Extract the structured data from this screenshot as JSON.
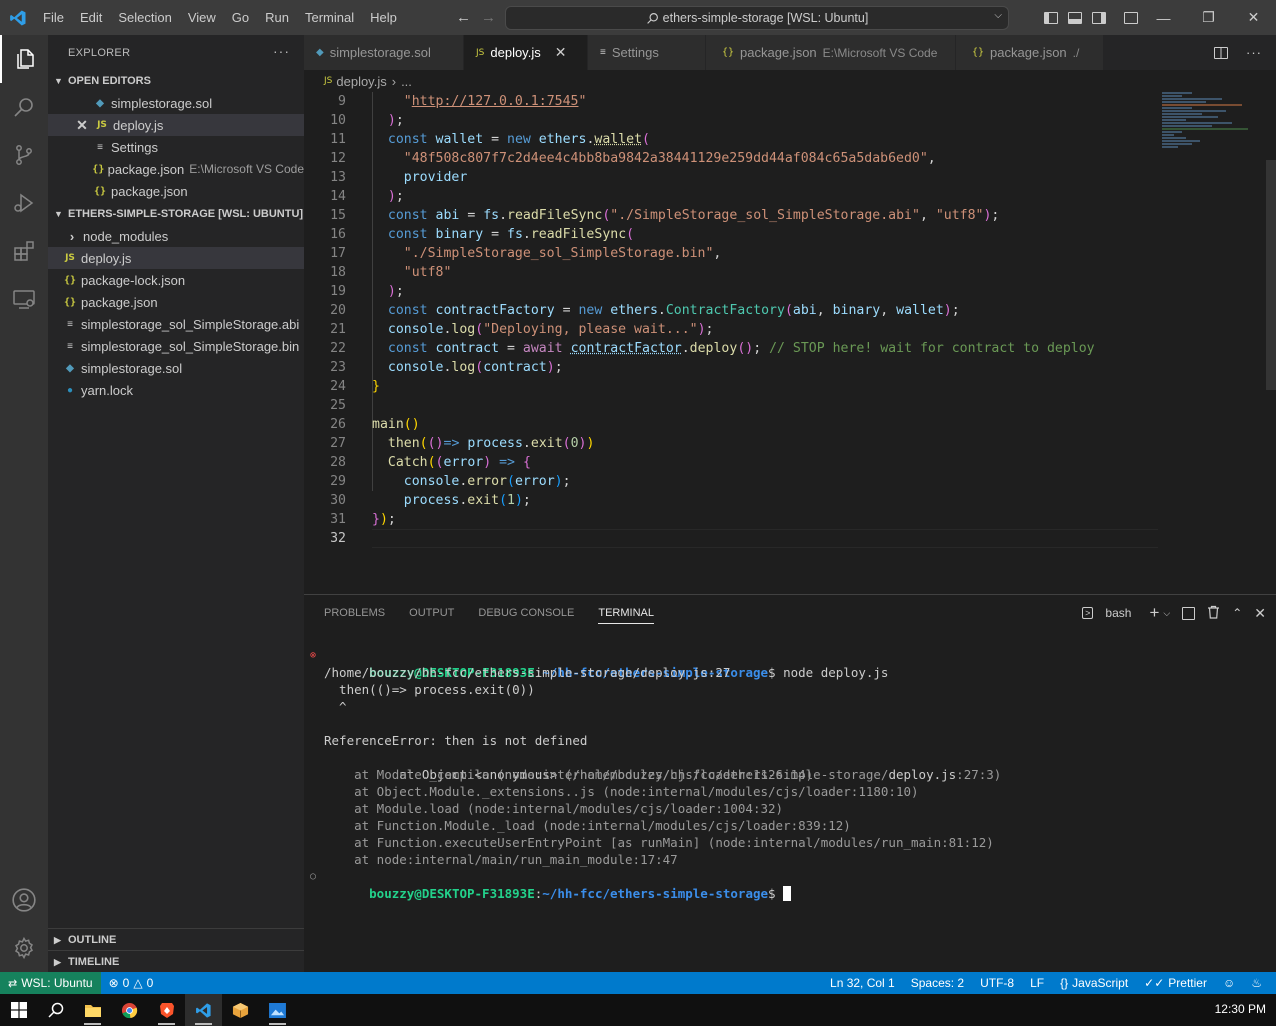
{
  "titlebar": {
    "menu": [
      "File",
      "Edit",
      "Selection",
      "View",
      "Go",
      "Run",
      "Terminal",
      "Help"
    ],
    "command_center": "ethers-simple-storage [WSL: Ubuntu]"
  },
  "sidebar": {
    "header": "EXPLORER",
    "open_editors_title": "OPEN EDITORS",
    "open_editors": [
      {
        "name": "simplestorage.sol",
        "desc": "",
        "icon": "ethereum-icon"
      },
      {
        "name": "deploy.js",
        "desc": "",
        "icon": "js-icon"
      },
      {
        "name": "Settings",
        "desc": "",
        "icon": "settings-lines-icon"
      },
      {
        "name": "package.json",
        "desc": "E:\\Microsoft VS Code",
        "icon": "json-icon"
      },
      {
        "name": "package.json",
        "desc": "",
        "icon": "json-icon"
      }
    ],
    "folder_title": "ETHERS-SIMPLE-STORAGE [WSL: UBUNTU]",
    "files": [
      {
        "name": "node_modules",
        "icon": "folder-chevron-icon"
      },
      {
        "name": "deploy.js",
        "icon": "js-icon"
      },
      {
        "name": "package-lock.json",
        "icon": "json-icon"
      },
      {
        "name": "package.json",
        "icon": "json-icon"
      },
      {
        "name": "simplestorage_sol_SimpleStorage.abi",
        "icon": "lines-icon"
      },
      {
        "name": "simplestorage_sol_SimpleStorage.bin",
        "icon": "lines-icon"
      },
      {
        "name": "simplestorage.sol",
        "icon": "ethereum-icon"
      },
      {
        "name": "yarn.lock",
        "icon": "yarn-icon"
      }
    ],
    "outline": "OUTLINE",
    "timeline": "TIMELINE"
  },
  "tabs": [
    {
      "label": "simplestorage.sol",
      "desc": ""
    },
    {
      "label": "deploy.js",
      "desc": ""
    },
    {
      "label": "Settings",
      "desc": ""
    },
    {
      "label": "package.json",
      "desc": "E:\\Microsoft VS Code"
    },
    {
      "label": "package.json",
      "desc": "./"
    }
  ],
  "breadcrumb": {
    "file": "deploy.js",
    "rest": "..."
  },
  "editor": {
    "line_numbers": [
      "9",
      "10",
      "11",
      "12",
      "13",
      "14",
      "15",
      "16",
      "17",
      "18",
      "19",
      "20",
      "21",
      "22",
      "23",
      "24",
      "25",
      "26",
      "27",
      "28",
      "29",
      "30",
      "31",
      "32"
    ]
  },
  "panel": {
    "tabs": [
      "PROBLEMS",
      "OUTPUT",
      "DEBUG CONSOLE",
      "TERMINAL"
    ],
    "shell": "bash",
    "terminal": {
      "prompt_user": "bouzzy@DESKTOP-F31893E",
      "prompt_path": "~/hh-fcc/ethers-simple-storage",
      "command": " node deploy.js",
      "lines": [
        "/home/bouzzy/hh-fcc/ethers-simple-storage/deploy.js:27",
        "  then(()=> process.exit(0))",
        "  ^",
        "",
        "ReferenceError: then is not defined"
      ],
      "stack_first_prefix": "    at Object.<anonymous> ",
      "stack_first_path": "(/home/bouzzy/hh-fcc/ethers-simple-storage/",
      "stack_first_file": "deploy.js",
      "stack_first_suffix": ":27:3)",
      "stack": [
        "    at Module._compile (node:internal/modules/cjs/loader:1126:14)",
        "    at Object.Module._extensions..js (node:internal/modules/cjs/loader:1180:10)",
        "    at Module.load (node:internal/modules/cjs/loader:1004:32)",
        "    at Function.Module._load (node:internal/modules/cjs/loader:839:12)",
        "    at Function.executeUserEntryPoint [as runMain] (node:internal/modules/run_main:81:12)",
        "    at node:internal/main/run_main_module:17:47"
      ]
    }
  },
  "statusbar": {
    "remote": "WSL: Ubuntu",
    "errors": "0",
    "warnings": "0",
    "position": "Ln 32, Col 1",
    "spaces": "Spaces: 2",
    "encoding": "UTF-8",
    "eol": "LF",
    "language": "JavaScript",
    "formatter": "Prettier"
  },
  "taskbar": {
    "clock": "12:30 PM"
  },
  "colors": {
    "accent": "#007acc",
    "remote": "#16825d",
    "activity": "#333333",
    "sidebar": "#252526",
    "editor": "#1e1e1e"
  }
}
